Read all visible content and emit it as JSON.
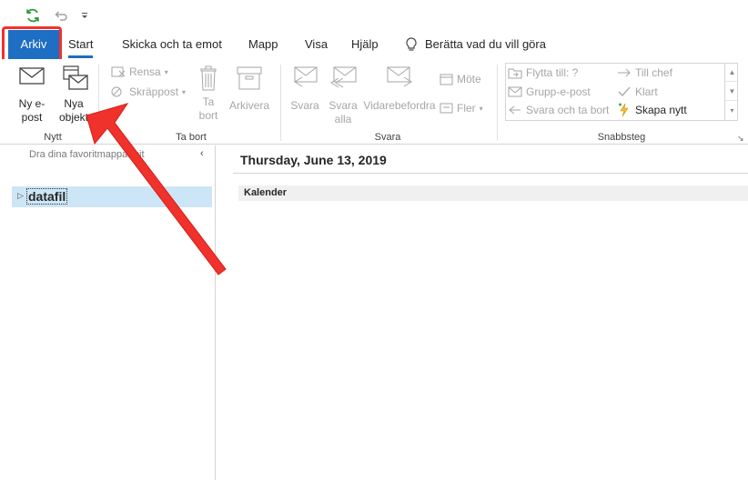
{
  "quick_access": {
    "icons": [
      "sync-icon",
      "undo-icon",
      "customize-dropdown-icon"
    ]
  },
  "tabs": [
    {
      "label": "Arkiv"
    },
    {
      "label": "Start"
    },
    {
      "label": "Skicka och ta emot"
    },
    {
      "label": "Mapp"
    },
    {
      "label": "Visa"
    },
    {
      "label": "Hjälp"
    }
  ],
  "tell_me": {
    "label": "Berätta vad du vill göra",
    "icon": "lightbulb-icon"
  },
  "ribbon": {
    "new_group": {
      "label": "Nytt",
      "new_email": [
        "Ny e-",
        "post"
      ],
      "new_items": [
        "Nya",
        "objekt"
      ]
    },
    "delete_group": {
      "label": "Ta bort",
      "clean": "Rensa",
      "junk": "Skräppost",
      "delete": [
        "Ta",
        "bort"
      ],
      "archive": "Arkivera"
    },
    "respond_group": {
      "label": "Svara",
      "reply": "Svara",
      "reply_all": [
        "Svara",
        "alla"
      ],
      "forward": "Vidarebefordra",
      "meeting": "Möte",
      "more": "Fler"
    },
    "quicksteps_group": {
      "label": "Snabbsteg",
      "move_to": "Flytta till: ?",
      "team_email": "Grupp-e-post",
      "reply_delete": "Svara och ta bort",
      "to_manager": "Till chef",
      "done": "Klart",
      "create_new": "Skapa nytt"
    }
  },
  "left_pane": {
    "favorites_hint": "Dra dina favoritmappar hit",
    "folder": "datafil"
  },
  "main": {
    "date": "Thursday, June 13, 2019",
    "calendar_label": "Kalender"
  },
  "colors": {
    "file_tab": "#1e6ec4",
    "highlight": "#f0322c",
    "selected_folder": "#cde6f7"
  }
}
